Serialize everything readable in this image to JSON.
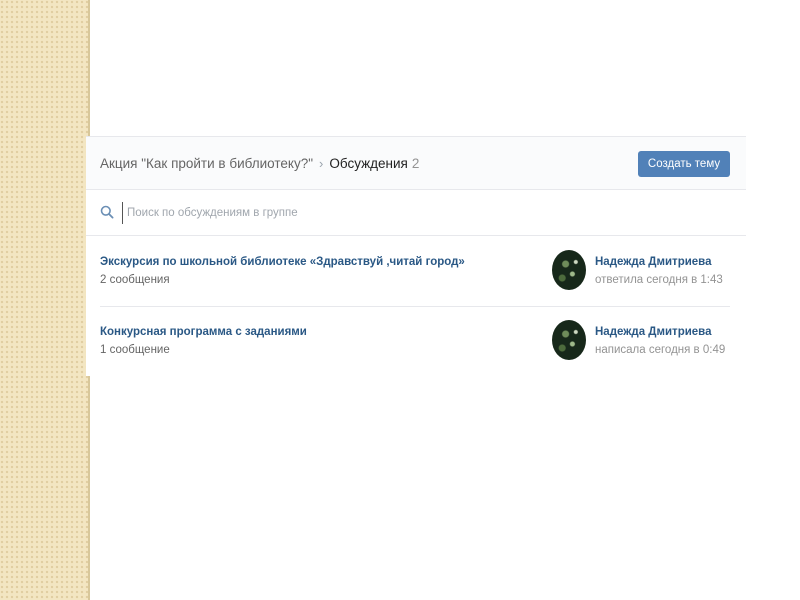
{
  "breadcrumb": {
    "group": "Акция \"Как пройти в библиотеку?\"",
    "separator": "›",
    "current": "Обсуждения",
    "count": "2"
  },
  "header": {
    "create_button": "Создать тему"
  },
  "search": {
    "placeholder": "Поиск по обсуждениям в группе",
    "value": "",
    "icon": "search-icon"
  },
  "topics": [
    {
      "title": "Экскурсия по школьной библиотеке «Здравствуй ,читай город»",
      "count": "2 сообщения",
      "author": "Надежда Дмитриева",
      "last_activity": "ответила сегодня в 1:43"
    },
    {
      "title": "Конкурсная программа с заданиями",
      "count": "1 сообщение",
      "author": "Надежда Дмитриева",
      "last_activity": "написала сегодня в 0:49"
    }
  ],
  "colors": {
    "accent": "#5181b8",
    "link": "#2a5885",
    "side_pattern": "#f3e6c2"
  }
}
